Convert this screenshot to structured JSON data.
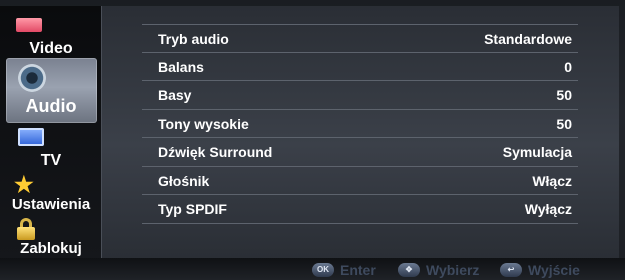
{
  "sidebar": {
    "items": [
      {
        "label": "Video"
      },
      {
        "label": "Audio"
      },
      {
        "label": "TV"
      },
      {
        "label": "Ustawienia"
      },
      {
        "label": "Zablokuj"
      }
    ]
  },
  "menu": {
    "rows": [
      {
        "name": "Tryb audio",
        "value": "Standardowe"
      },
      {
        "name": "Balans",
        "value": "0"
      },
      {
        "name": "Basy",
        "value": "50"
      },
      {
        "name": "Tony wysokie",
        "value": "50"
      },
      {
        "name": "Dźwięk Surround",
        "value": "Symulacja"
      },
      {
        "name": "Głośnik",
        "value": "Włącz"
      },
      {
        "name": "Typ SPDIF",
        "value": "Wyłącz"
      }
    ]
  },
  "footer": {
    "enter": {
      "key": "OK",
      "label": "Enter"
    },
    "select": {
      "key": "✥",
      "label": "Wybierz"
    },
    "exit": {
      "key": "↩",
      "label": "Wyjście"
    }
  }
}
